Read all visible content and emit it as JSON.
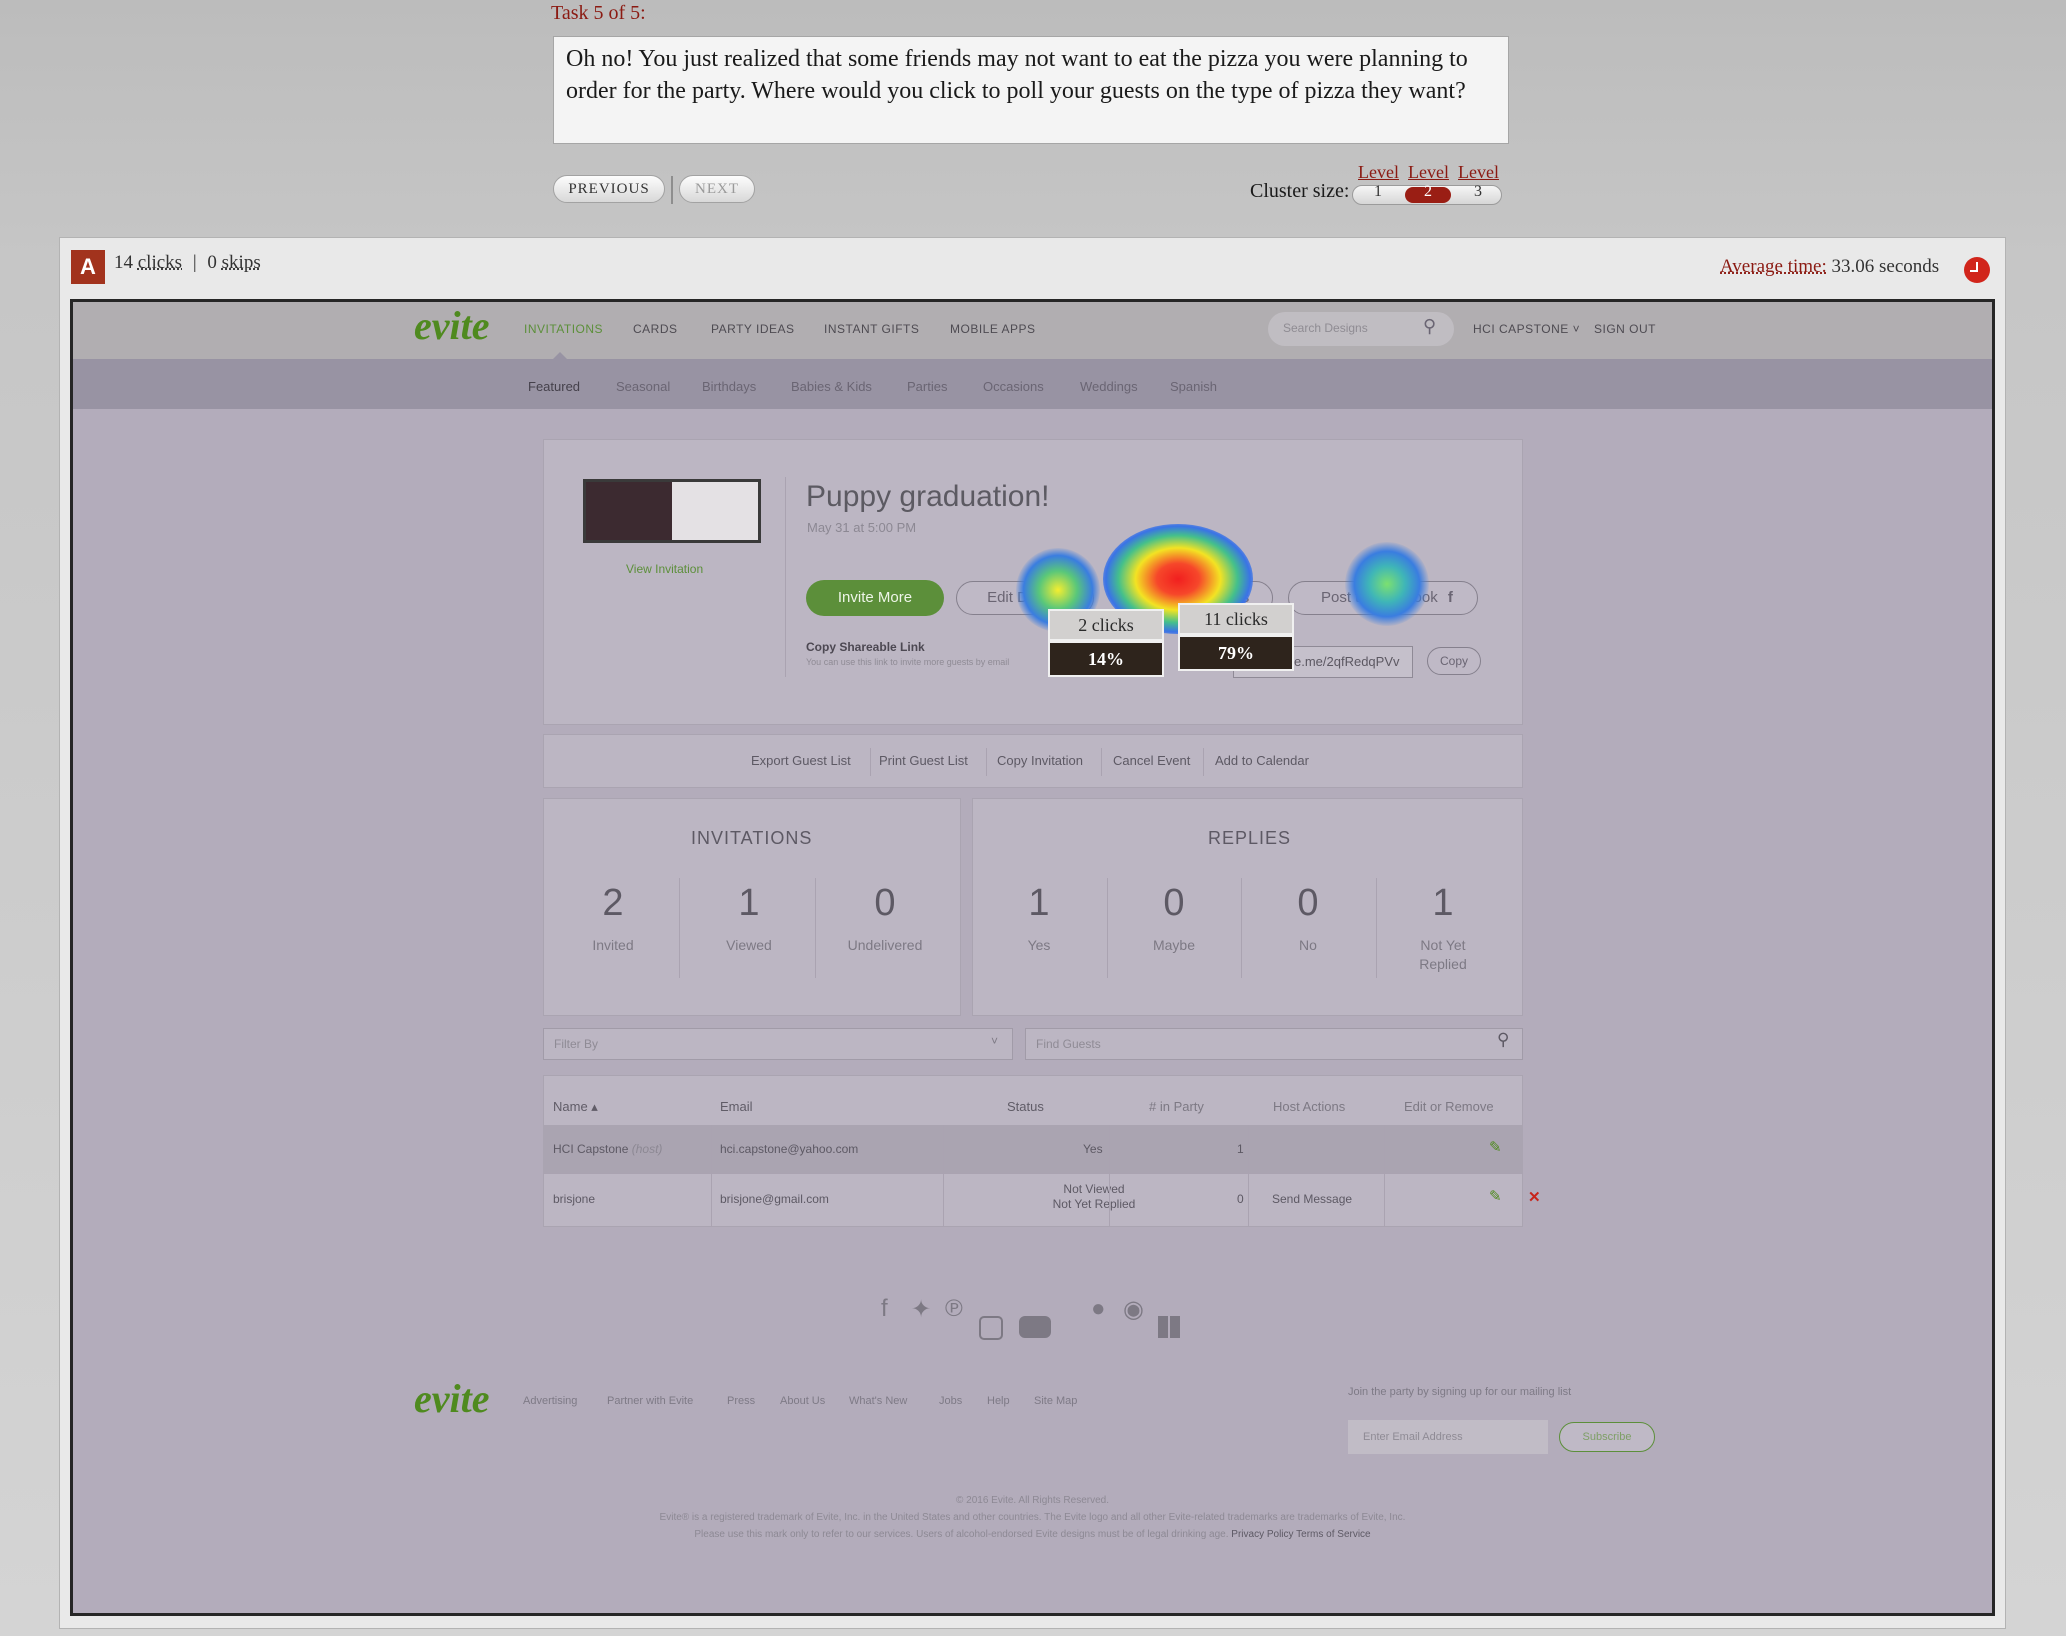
{
  "task": {
    "label": "Task 5 of 5:",
    "prompt": "Oh no! You just realized that some friends may not want to eat the pizza you were planning to order for the party. Where would you click to poll your guests on the type of pizza they want?",
    "previous": "PREVIOUS",
    "next": "NEXT"
  },
  "cluster": {
    "label": "Cluster size:",
    "levels": [
      "Level",
      "Level",
      "Level"
    ],
    "options": [
      "1",
      "2",
      "3"
    ],
    "selected": "2"
  },
  "results": {
    "badge": "A",
    "clicks": "14",
    "clicks_label": "clicks",
    "skips": "0",
    "skips_label": "skips",
    "avg_label": "Average time:",
    "avg_value": "33.06 seconds"
  },
  "evite": {
    "logo": "evite",
    "nav": [
      "INVITATIONS",
      "CARDS",
      "PARTY IDEAS",
      "INSTANT GIFTS",
      "MOBILE APPS"
    ],
    "search_placeholder": "Search Designs",
    "account": "HCI CAPSTONE",
    "signout": "SIGN OUT",
    "subnav": [
      "Featured",
      "Seasonal",
      "Birthdays",
      "Babies & Kids",
      "Parties",
      "Occasions",
      "Weddings",
      "Spanish"
    ],
    "event": {
      "view_invitation": "View Invitation",
      "title": "Puppy graduation!",
      "date": "May 31 at 5:00 PM",
      "invite_more": "Invite More",
      "edit_details": "Edit Details",
      "message_guests": "Message Guests",
      "post_facebook": "Post to Facebook",
      "copy_link_label": "Copy Shareable Link",
      "copy_link_help": "You can use this link to invite more guests by email",
      "link_value": "e.me/2qfRedqPVv",
      "copy": "Copy"
    },
    "actions": [
      "Export Guest List",
      "Print Guest List",
      "Copy Invitation",
      "Cancel Event",
      "Add to Calendar"
    ],
    "invitations": {
      "title": "INVITATIONS",
      "stats": [
        {
          "value": "2",
          "label": "Invited"
        },
        {
          "value": "1",
          "label": "Viewed"
        },
        {
          "value": "0",
          "label": "Undelivered"
        }
      ]
    },
    "replies": {
      "title": "REPLIES",
      "stats": [
        {
          "value": "1",
          "label": "Yes"
        },
        {
          "value": "0",
          "label": "Maybe"
        },
        {
          "value": "0",
          "label": "No"
        },
        {
          "value": "1",
          "label": "Not Yet Replied"
        }
      ]
    },
    "filter_placeholder": "Filter By",
    "find_placeholder": "Find Guests",
    "table": {
      "headers": [
        "Name ▴",
        "Email",
        "Status",
        "# in Party",
        "Host Actions",
        "Edit or Remove"
      ],
      "rows": [
        {
          "name": "HCI Capstone",
          "host_tag": "(host)",
          "email": "hci.capstone@yahoo.com",
          "status": "Yes",
          "party": "1",
          "action": ""
        },
        {
          "name": "brisjone",
          "host_tag": "",
          "email": "brisjone@gmail.com",
          "status": "Not Viewed",
          "status2": "Not Yet Replied",
          "party": "0",
          "action": "Send Message"
        }
      ]
    },
    "footer": {
      "logo": "evite",
      "links": [
        "Advertising",
        "Partner with Evite",
        "Press",
        "About Us",
        "What's New",
        "Jobs",
        "Help",
        "Site Map"
      ],
      "mailing": "Join the party by signing up for our mailing list",
      "email_placeholder": "Enter Email Address",
      "subscribe": "Subscribe",
      "copyright": "© 2016 Evite. All Rights Reserved.",
      "legal1": "Evite® is a registered trademark of Evite, Inc. in the United States and other countries. The Evite logo and all other Evite-related trademarks are trademarks of Evite, Inc.",
      "legal2": "Please use this mark only to refer to our services. Users of alcohol-endorsed Evite designs must be of legal drinking age.",
      "privacy": "Privacy Policy",
      "terms": "Terms of Service"
    }
  },
  "heatmap": [
    {
      "target": "edit-details",
      "clicks": "2 clicks",
      "percent": "14%",
      "share": 0.14
    },
    {
      "target": "message-guests",
      "clicks": "11 clicks",
      "percent": "79%",
      "share": 0.79
    }
  ],
  "colors": {
    "accent_red": "#8b1a12",
    "evite_green": "#5c8f3a",
    "overlay": "#b3acbb"
  }
}
